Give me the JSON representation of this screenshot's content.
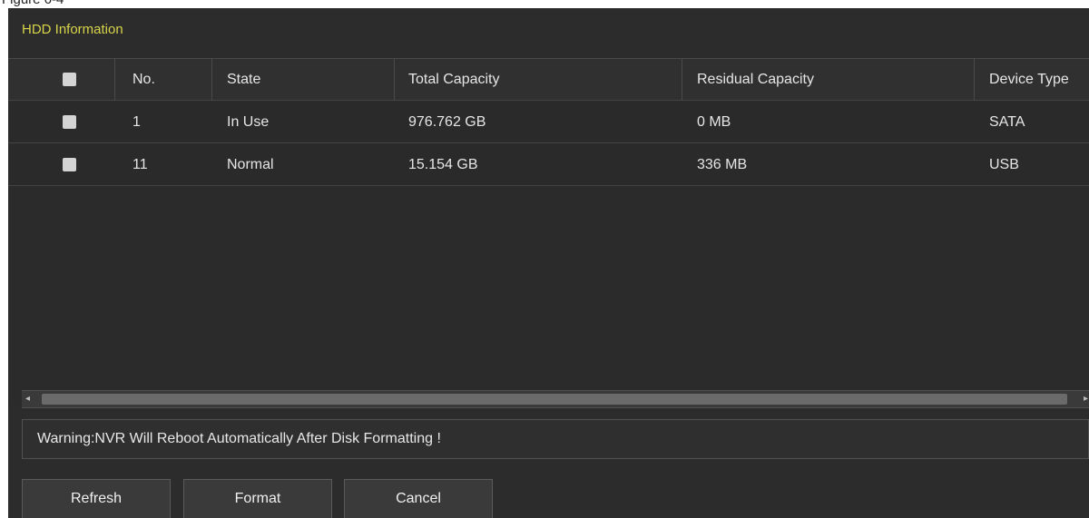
{
  "page_caption": "Figure 6-4",
  "section": {
    "title": "HDD Information"
  },
  "table": {
    "headers": [
      "No.",
      "State",
      "Total Capacity",
      "Residual Capacity",
      "Device Type"
    ],
    "rows": [
      {
        "no": "1",
        "state": "In Use",
        "total": "976.762 GB",
        "residual": "0 MB",
        "device": "SATA"
      },
      {
        "no": "11",
        "state": "Normal",
        "total": "15.154 GB",
        "residual": "336 MB",
        "device": "USB"
      }
    ]
  },
  "scrollbar": {
    "left_arrow": "◂",
    "right_arrow": "▸"
  },
  "warning": {
    "text": "Warning:NVR Will Reboot Automatically After Disk Formatting !"
  },
  "buttons": {
    "refresh": "Refresh",
    "format": "Format",
    "cancel": "Cancel"
  },
  "colors": {
    "panel_bg": "#2c2c2c",
    "title": "#d8d44a",
    "text": "#e6e6e6"
  }
}
